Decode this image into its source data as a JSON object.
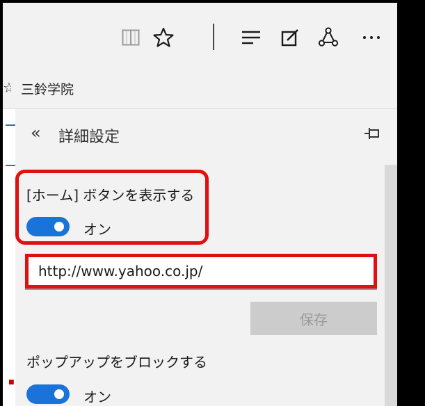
{
  "favorites": {
    "site_label": "三鈴学院"
  },
  "settings": {
    "title": "詳細設定",
    "home_button": {
      "label": "[ホーム] ボタンを表示する",
      "state": "オン"
    },
    "home_url": {
      "value": "http://www.yahoo.co.jp/"
    },
    "save_label": "保存",
    "popup_block": {
      "label": "ポップアップをブロックする",
      "state": "オン"
    }
  },
  "colors": {
    "toggle_on": "#1a73d9",
    "highlight": "#e01010"
  }
}
